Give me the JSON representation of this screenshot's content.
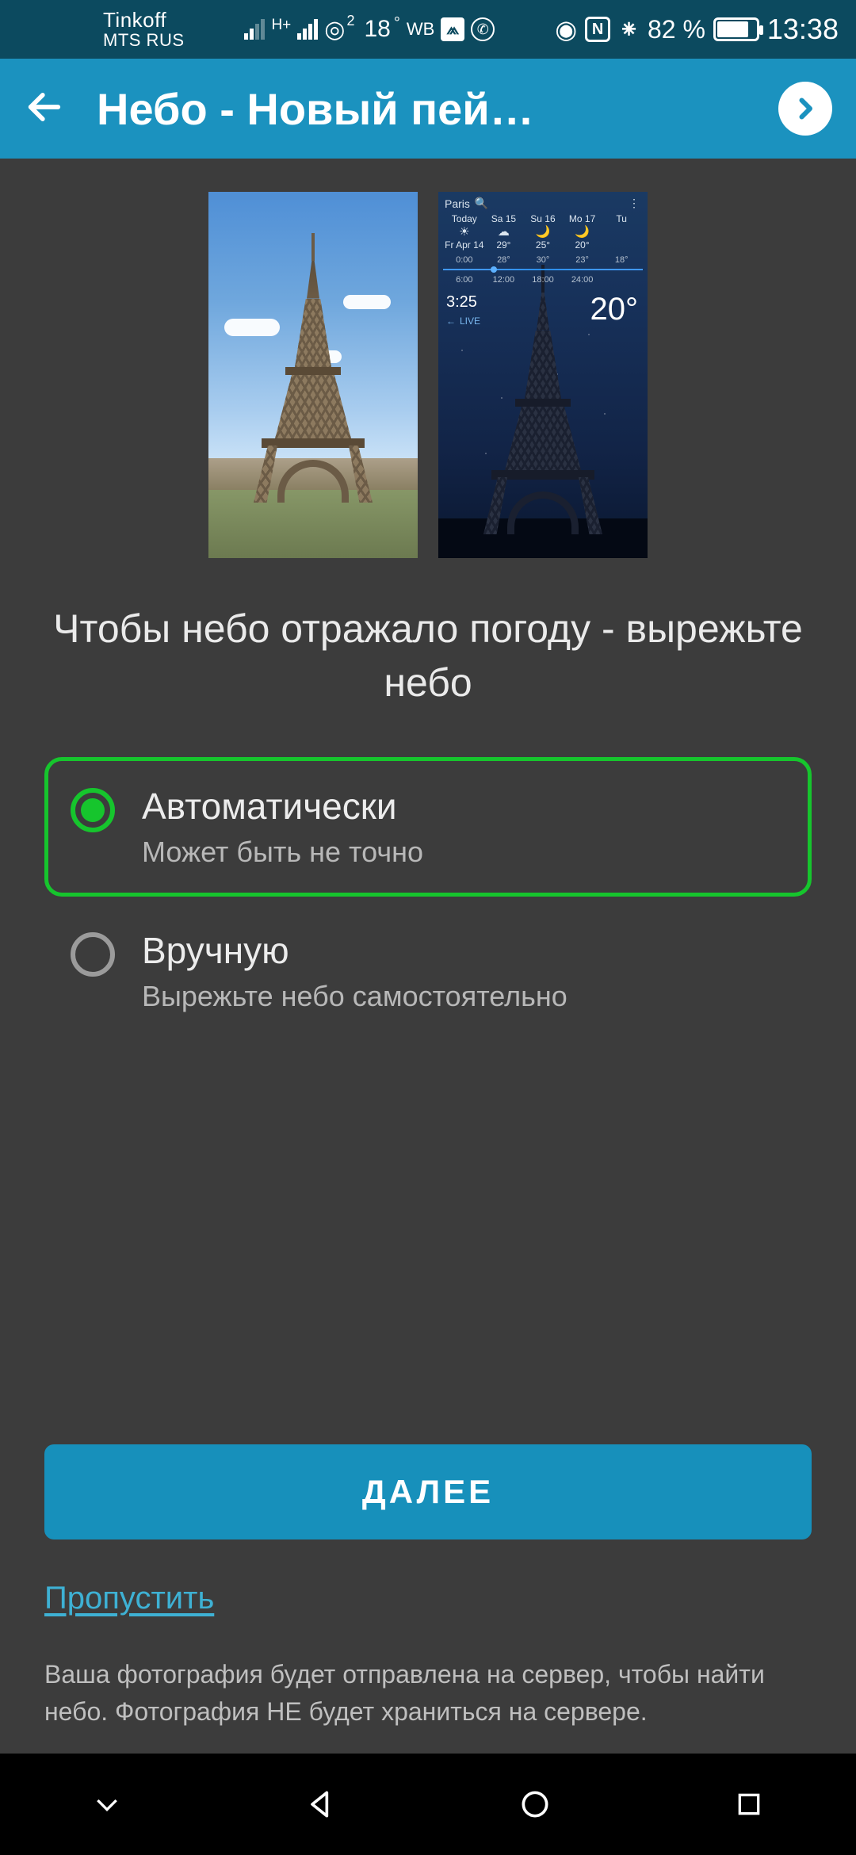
{
  "statusbar": {
    "carrier1": "Tinkoff",
    "carrier2": "MTS RUS",
    "temp": "18",
    "temp_unit": "°",
    "wb": "WB",
    "net_badge": "H+",
    "hotspot_sup": "2",
    "battery_pct": "82 %",
    "time": "13:38"
  },
  "appbar": {
    "title": "Небо - Новый пей…"
  },
  "preview_right": {
    "location": "Paris",
    "days": [
      {
        "top": "Today",
        "bottom": "Fr Apr 14",
        "icon": "☀"
      },
      {
        "top": "Sa 15",
        "bottom": "29°",
        "icon": "☁"
      },
      {
        "top": "Su 16",
        "bottom": "25°",
        "icon": "🌙"
      },
      {
        "top": "Mo 17",
        "bottom": "20°",
        "icon": "🌙"
      },
      {
        "top": "Tu",
        "bottom": "",
        "icon": ""
      }
    ],
    "hours": [
      {
        "h": "0:00",
        "t": "",
        "b": "6:00"
      },
      {
        "h": "",
        "t": "28°",
        "b": "12:00"
      },
      {
        "h": "",
        "t": "30°",
        "b": "18:00"
      },
      {
        "h": "",
        "t": "23°",
        "b": "24:00"
      },
      {
        "h": "",
        "t": "18°",
        "b": ""
      }
    ],
    "big_temp": "20°",
    "small_time": "3:25",
    "live": "LIVE"
  },
  "instruction": "Чтобы небо отражало погоду - вырежьте небо",
  "options": {
    "auto": {
      "title": "Автоматически",
      "sub": "Может быть не точно"
    },
    "manual": {
      "title": "Вручную",
      "sub": "Вырежьте небо самостоятельно"
    }
  },
  "footer": {
    "next": "ДАЛЕЕ",
    "skip": "Пропустить",
    "disclaimer": "Ваша фотография будет отправлена на сервер, чтобы найти небо. Фотография НЕ будет храниться на сервере."
  }
}
